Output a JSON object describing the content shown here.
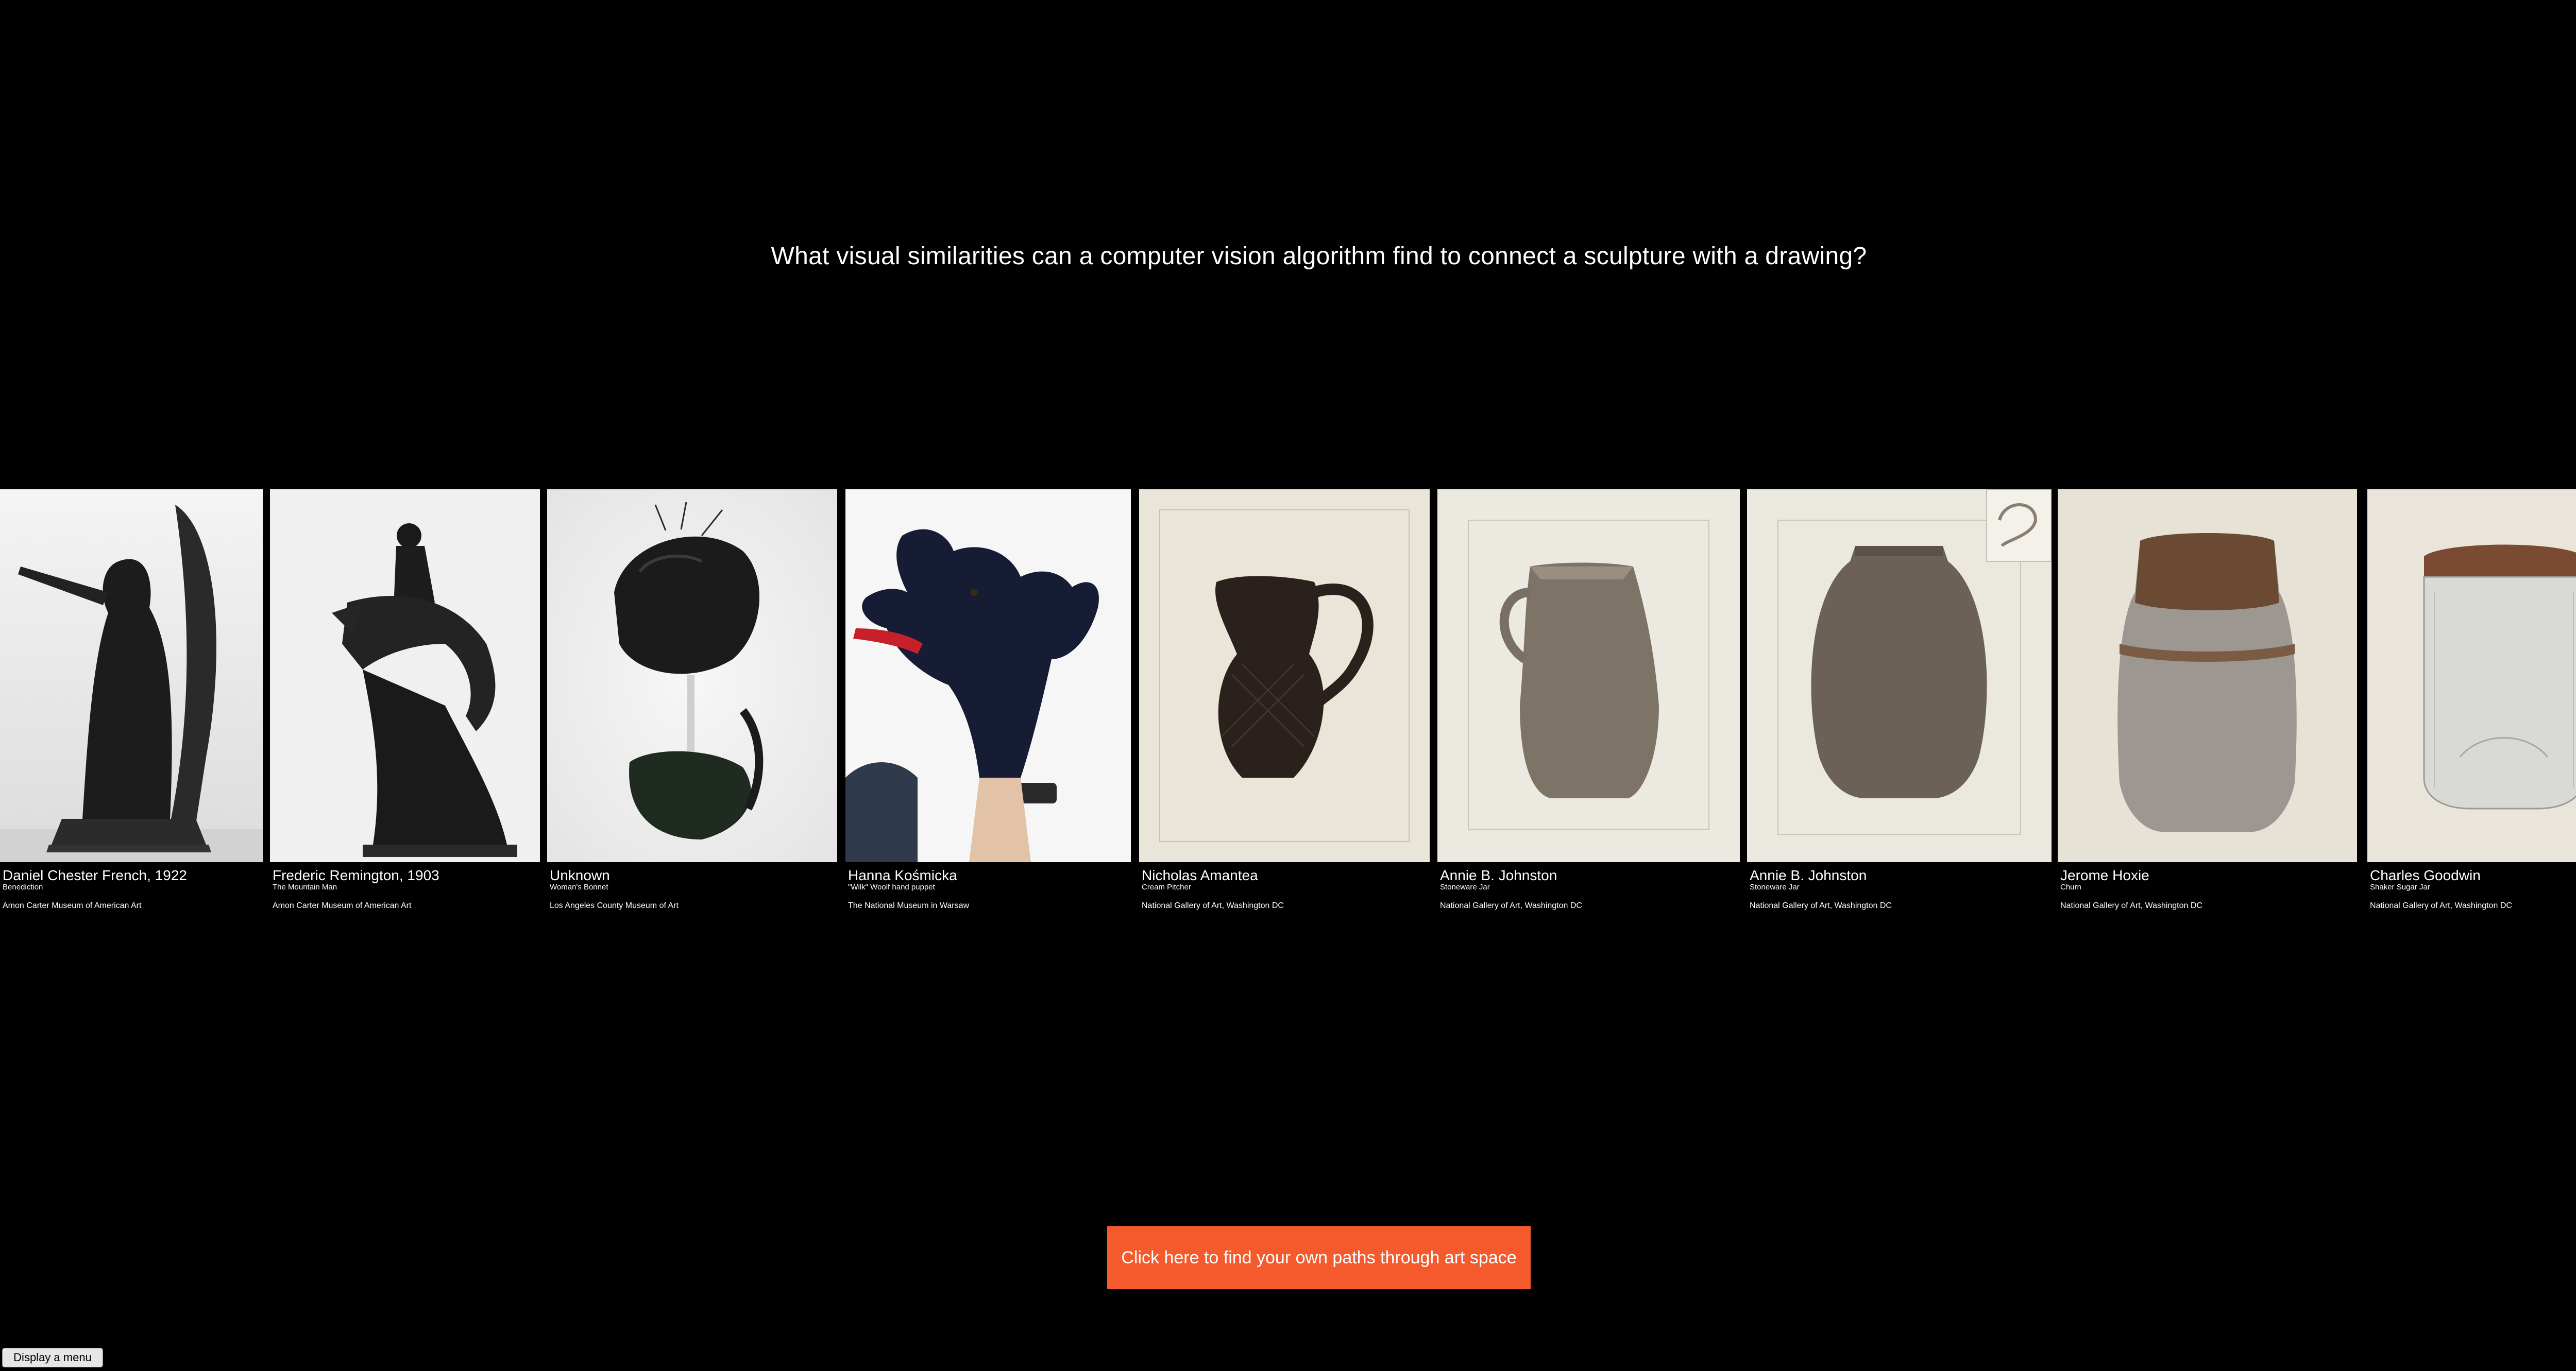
{
  "headline": "What visual similarities can a computer vision algorithm find to connect a sculpture with a drawing?",
  "artworks": [
    {
      "artist": "Daniel Chester French, 1922",
      "title": "Benediction",
      "museum": "Amon Carter Museum of American Art",
      "icon": "bronze-winged-figure-sculpture"
    },
    {
      "artist": "Frederic Remington, 1903",
      "title": "The Mountain Man",
      "museum": "Amon Carter Museum of American Art",
      "icon": "bronze-horse-rider-sculpture"
    },
    {
      "artist": "Unknown",
      "title": "Woman's Bonnet",
      "museum": "Los Angeles County Museum of Art",
      "icon": "black-bonnet-on-stand"
    },
    {
      "artist": "Hanna Kośmicka",
      "title": "\"Wilk\" Woolf hand puppet",
      "museum": "The National Museum in Warsaw",
      "icon": "wolf-hand-puppet"
    },
    {
      "artist": "Nicholas Amantea",
      "title": "Cream Pitcher",
      "museum": "National Gallery of Art, Washington DC",
      "icon": "dark-cream-pitcher-drawing"
    },
    {
      "artist": "Annie B. Johnston",
      "title": "Stoneware Jar",
      "museum": "National Gallery of Art, Washington DC",
      "icon": "stoneware-pitcher-drawing"
    },
    {
      "artist": "Annie B. Johnston",
      "title": "Stoneware Jar",
      "museum": "National Gallery of Art, Washington DC",
      "icon": "stoneware-jar-drawing"
    },
    {
      "artist": "Jerome Hoxie",
      "title": "Churn",
      "museum": "National Gallery of Art, Washington DC",
      "icon": "churn-drawing"
    },
    {
      "artist": "Charles Goodwin",
      "title": "Shaker Sugar Jar",
      "museum": "National Gallery of Art, Washington DC",
      "icon": "glass-sugar-jar-drawing"
    }
  ],
  "cta_label": "Click here to find your own paths through art space",
  "menu_label": "Display a menu",
  "colors": {
    "background": "#000000",
    "cta": "#f55a2c",
    "text": "#ffffff"
  }
}
